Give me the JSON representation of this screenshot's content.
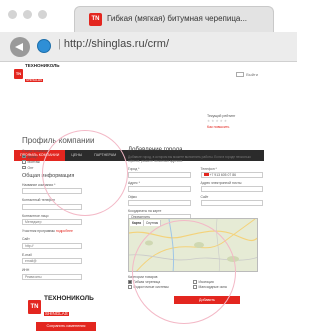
{
  "browser": {
    "tab_title": "Гибкая (мягкая) битумная черепица...",
    "favicon": "TN",
    "url": "http://shinglas.ru/crm/"
  },
  "logo": {
    "name": "ТЕХНОНИКОЛЬ",
    "sub": "SHINGLAS"
  },
  "header": {
    "exit": "Выйти"
  },
  "rating": {
    "title": "Текущий рейтинг",
    "stars": "★★★★★",
    "link": "Как повысить"
  },
  "nav": {
    "items": [
      "ПРОФИЛЬ КОМПАНИИ",
      "ЦЕНЫ",
      "ПАРТНЕРАМ"
    ]
  },
  "profile": {
    "title": "Профиль компании",
    "status_label": "Статус компании",
    "status_options": [
      "Дилер",
      "Монтаж",
      "Опт"
    ],
    "general_title": "Общая информация",
    "company_label": "Название компании *",
    "phone_label": "Контактный телефон",
    "person_label": "Контактное лицо",
    "person_value": "Менеджер",
    "site_label": "Сайт",
    "site_value": "http://",
    "email_label": "E-mail",
    "email_value": "email@",
    "inn_label": "ИНН",
    "inn_value": "Реквизиты",
    "reg_note": "Участник программы",
    "reg_link": "подробнее"
  },
  "address": {
    "title": "Добавление города",
    "hint": "Добавьте город, в котором вы можете выполнить работы. Если в городе несколько офисов, укажите несколько адресов.",
    "city_label": "Город *",
    "phone_label": "Телефон *",
    "phone_value": "+7 913 605 07 86",
    "street_label": "Адрес *",
    "address_label": "Адрес электронной почты",
    "office_label": "Офис",
    "site_label": "Сайт",
    "coords_label": "Координаты на карте",
    "coords_value": "Определить",
    "map_tabs": [
      "Карта",
      "Спутник"
    ],
    "categories_title": "Категории товаров",
    "categories": [
      "Гибкая черепица",
      "Изоляция",
      "Водосточные системы",
      "Мансардные окна"
    ],
    "add_button": "Добавить"
  },
  "sidebar_logo": {
    "name": "ТЕХНОНИКОЛЬ",
    "sub": "SHINGLAS"
  },
  "save_button": "Сохранить изменения",
  "colors": {
    "accent": "#e3261f",
    "nav_bg": "#2b2b2b",
    "circle": "#f3b8c6"
  },
  "icons": [
    "back-arrow-icon",
    "globe-icon",
    "star-icon",
    "exit-icon",
    "checkbox-icon"
  ]
}
